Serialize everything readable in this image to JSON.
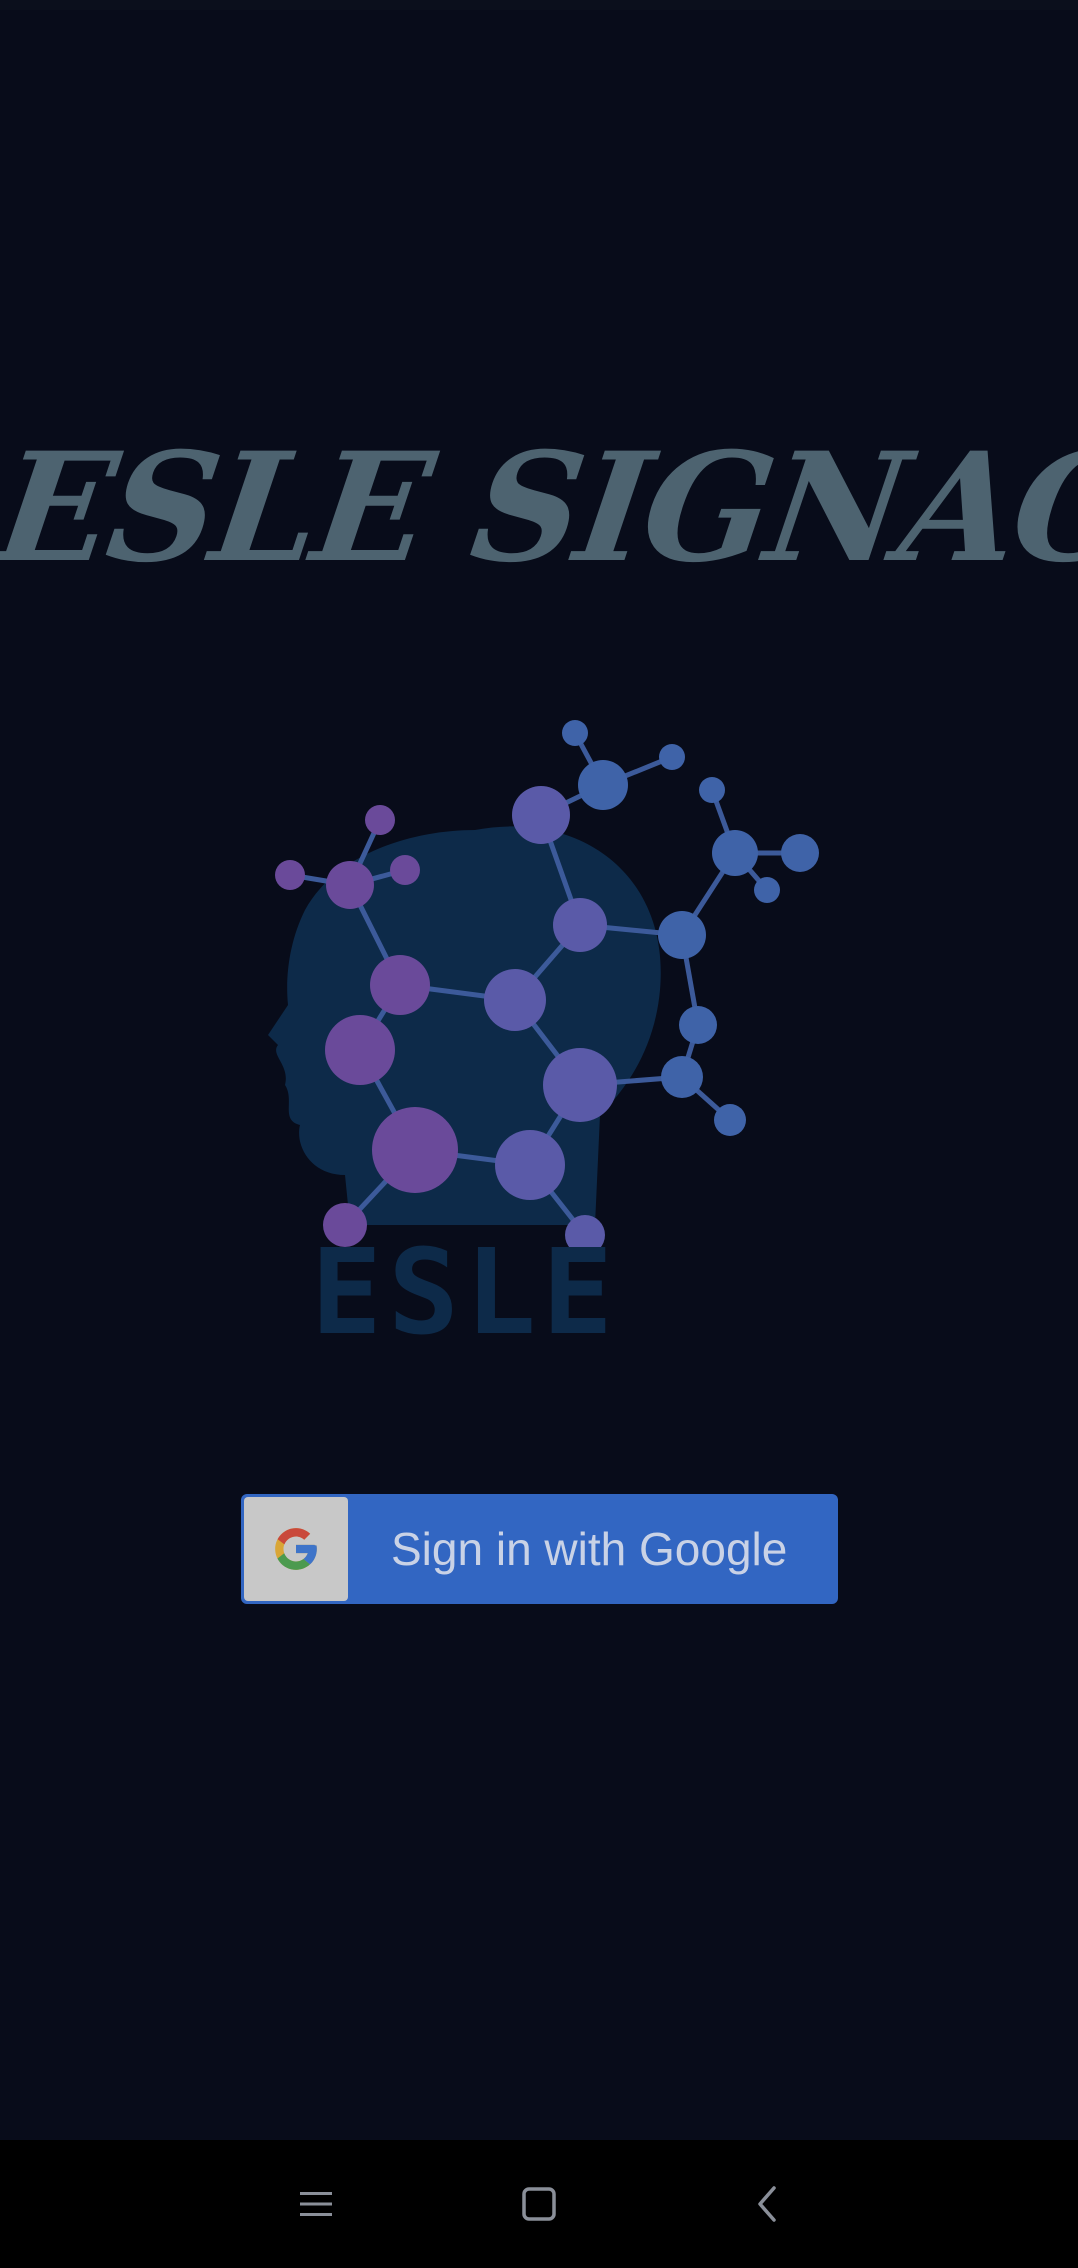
{
  "app": {
    "title": "ESLE SIGNAGE"
  },
  "logo": {
    "icon": "head-molecule-logo",
    "wordmark": "ESLE"
  },
  "signin": {
    "label": "Sign in with Google",
    "icon": "google-g-icon",
    "button_color": "#3266c2"
  },
  "nav": {
    "recents_icon": "menu-lines-icon",
    "home_icon": "square-home-icon",
    "back_icon": "chevron-left-back-icon"
  },
  "colors": {
    "background": "#080c1a",
    "title": "#4d6370"
  }
}
